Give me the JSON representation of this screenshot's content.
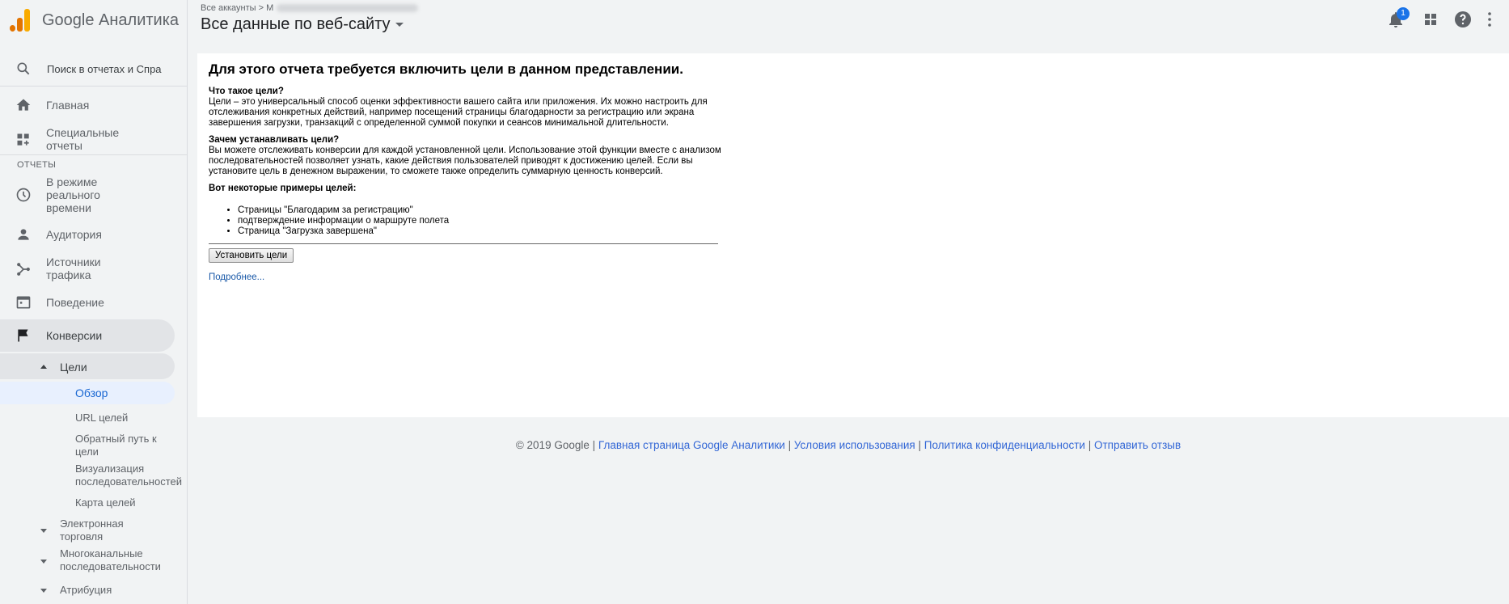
{
  "brand": {
    "name": "Google Аналитика"
  },
  "header": {
    "breadcrumb_root": "Все аккаунты",
    "breadcrumb_sep": ">",
    "breadcrumb_tail": "M",
    "view_title": "Все данные по веб-сайту",
    "notification_count": "1"
  },
  "sidebar": {
    "search_placeholder": "Поиск в отчетах и Справке",
    "home": "Главная",
    "custom_reports": "Специальные отчеты",
    "reports_section": "ОТЧЕТЫ",
    "realtime": "В режиме реального времени",
    "audience": "Аудитория",
    "acquisition": "Источники трафика",
    "behavior": "Поведение",
    "conversions": "Конверсии",
    "goals": "Цели",
    "goals_sub": [
      "Обзор",
      "URL целей",
      "Обратный путь к цели",
      "Визуализация последовательностей",
      "Карта целей"
    ],
    "ecommerce": "Электронная торговля",
    "multichannel": "Многоканальные последовательности",
    "attribution": "Атрибуция"
  },
  "main": {
    "heading": "Для этого отчета требуется включить цели в данном представлении.",
    "what_title": "Что такое цели?",
    "what_text": "Цели – это универсальный способ оценки эффективности вашего сайта или приложения. Их можно настроить для отслеживания конкретных действий, например посещений страницы благодарности за регистрацию или экрана завершения загрузки, транзакций с определенной суммой покупки и сеансов минимальной длительности.",
    "why_title": "Зачем устанавливать цели?",
    "why_text": "Вы можете отслеживать конверсии для каждой установленной цели. Использование этой функции вместе с анализом последовательностей позволяет узнать, какие действия пользователей приводят к достижению целей. Если вы установите цель в денежном выражении, то сможете также определить суммарную ценность конверсий.",
    "examples_title": "Вот некоторые примеры целей:",
    "examples": [
      "Страницы \"Благодарим за регистрацию\"",
      "подтверждение информации о маршруте полета",
      "Страница \"Загрузка завершена\""
    ],
    "button_label": "Установить цели",
    "more_link": "Подробнее..."
  },
  "footer": {
    "copyright": "© 2019 Google",
    "sep": "|",
    "links": [
      "Главная страница Google Аналитики",
      "Условия использования",
      "Политика конфиденциальности",
      "Отправить отзыв"
    ]
  },
  "colors": {
    "accent": "#1a73e8",
    "active_bg": "#e8f0fe",
    "link": "#3367d6"
  }
}
